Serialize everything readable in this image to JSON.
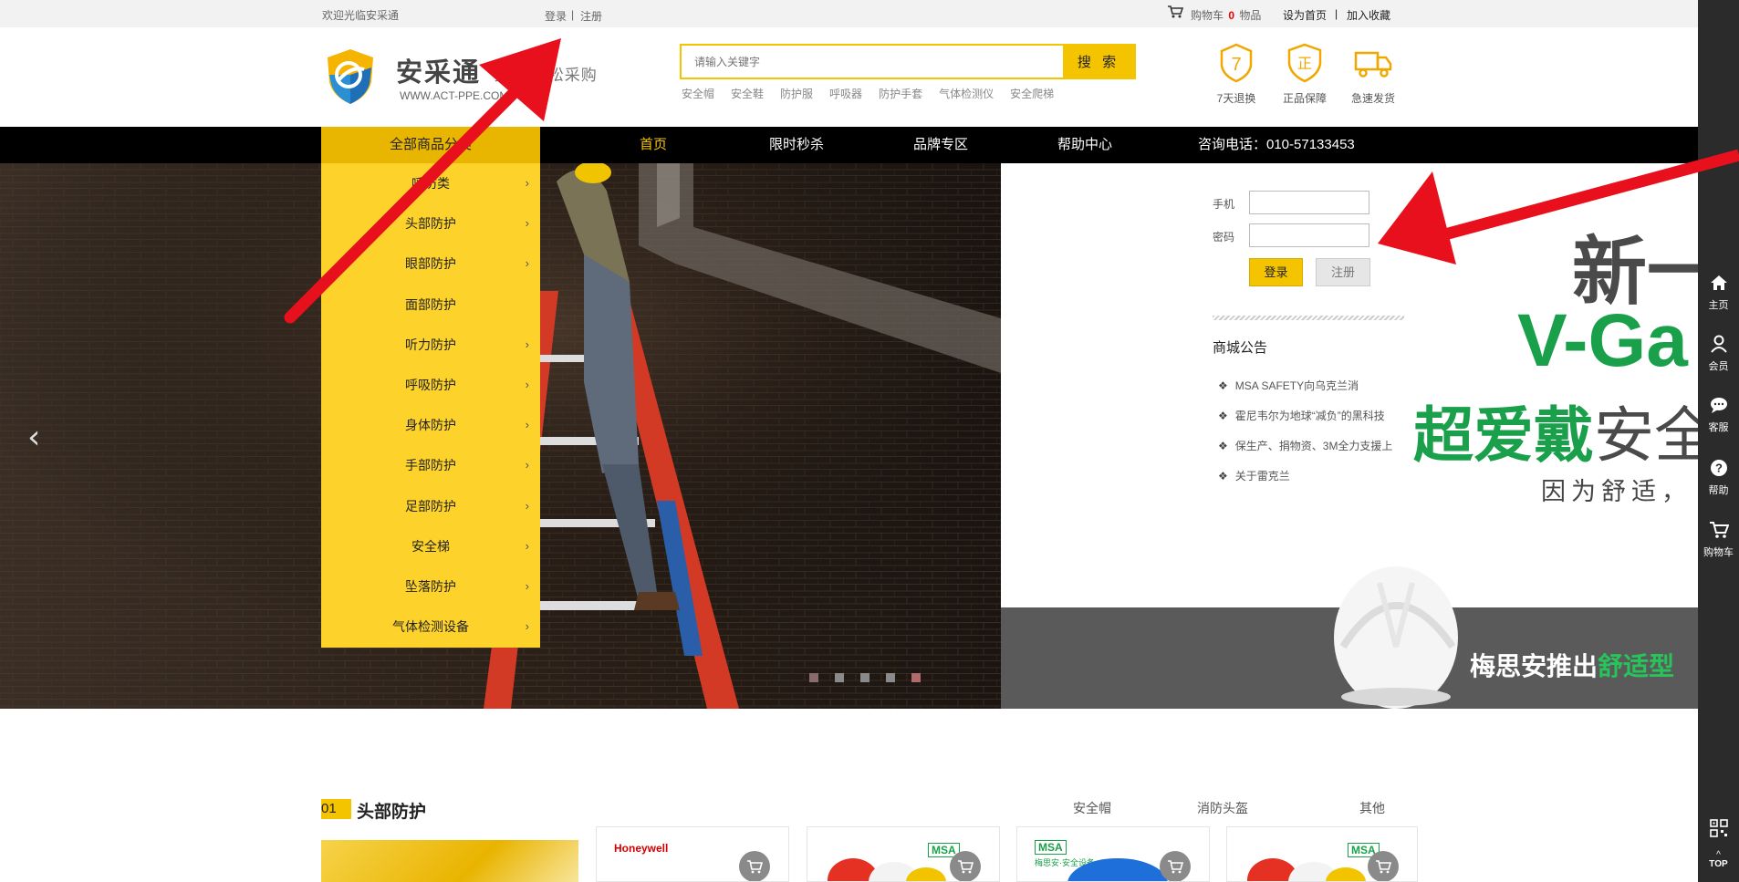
{
  "topbar": {
    "welcome": "欢迎光临安采通",
    "login": "登录",
    "sep": "|",
    "register": "注册",
    "cart_prefix": "购物车",
    "cart_count": "0",
    "cart_suffix": "物品",
    "set_home": "设为首页",
    "sep2": "|",
    "bookmark": "加入收藏"
  },
  "header": {
    "logo_title": "安采通",
    "logo_url": "WWW.ACT-PPE.COM",
    "slogan": "安全 轻松采购",
    "search_placeholder": "请输入关键字",
    "search_button": "搜 索",
    "hot_keys": [
      "安全帽",
      "安全鞋",
      "防护服",
      "呼吸器",
      "防护手套",
      "气体检测仪",
      "安全爬梯"
    ],
    "services": [
      {
        "label": "7天退换",
        "icon": "return-7-days-icon"
      },
      {
        "label": "正品保障",
        "icon": "genuine-shield-icon"
      },
      {
        "label": "急速发货",
        "icon": "delivery-truck-icon"
      }
    ]
  },
  "nav": {
    "all_categories": "全部商品分类",
    "items": [
      "首页",
      "限时秒杀",
      "品牌专区",
      "帮助中心"
    ],
    "active": "首页",
    "hotline": "咨询电话：010-57133453"
  },
  "categories": [
    "呼防类",
    "头部防护",
    "眼部防护",
    "面部防护",
    "听力防护",
    "呼吸防护",
    "身体防护",
    "手部防护",
    "足部防护",
    "安全梯",
    "坠落防护",
    "气体检测设备"
  ],
  "login_panel": {
    "phone_label": "手机",
    "password_label": "密码",
    "login_button": "登录",
    "register_button": "注册",
    "notice_title": "商城公告",
    "notices": [
      "MSA SAFETY向乌克兰消",
      "霍尼韦尔为地球“减负”的黑科技",
      "保生产、捐物资、3M全力支援上",
      "关于雷克兰"
    ]
  },
  "banner": {
    "headline_1": "新一",
    "headline_2": "V-Ga",
    "headline_3_a": "超爱戴",
    "headline_3_b": "安全",
    "headline_4": "因为舒适，",
    "footer_a": "梅思安推出",
    "footer_b": "舒适型",
    "dots": 5,
    "active_dot": 4
  },
  "sidebar": {
    "items": [
      {
        "label": "主页",
        "icon": "home-icon"
      },
      {
        "label": "会员",
        "icon": "user-icon"
      },
      {
        "label": "客服",
        "icon": "chat-icon"
      },
      {
        "label": "帮助",
        "icon": "help-icon"
      },
      {
        "label": "购物车",
        "icon": "cart-icon"
      }
    ],
    "qr_icon": "qrcode-icon",
    "top_label": "TOP"
  },
  "section": {
    "number": "01",
    "title": "头部防护",
    "tabs": [
      "安全帽",
      "消防头盔",
      "其他"
    ],
    "brands": [
      "Honeywell",
      "MSA",
      "MSA",
      "MSA"
    ],
    "msa_sub": "梅思安·安全设备"
  },
  "colors": {
    "accent": "#f5c400",
    "menu_bg": "#fdd22b",
    "nav_bg": "#000000",
    "annotation_arrow": "#e8101c",
    "green": "#1aa04a"
  }
}
